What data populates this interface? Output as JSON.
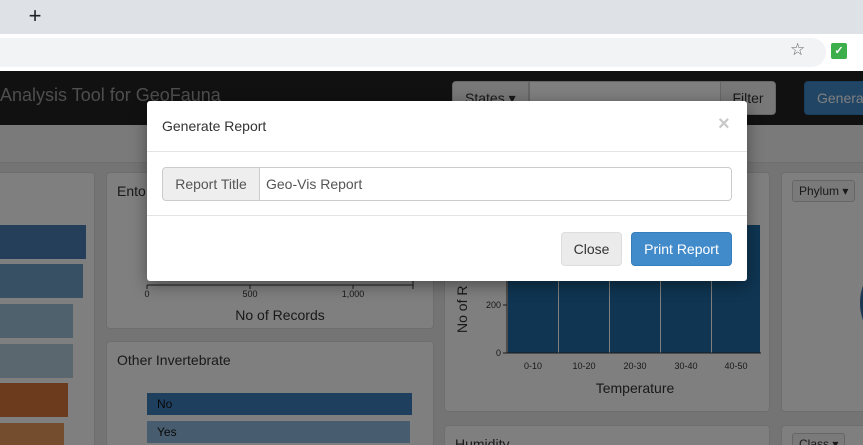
{
  "browser": {
    "new_tab_glyph": "+",
    "star_glyph": "☆",
    "extension_glyph": "✓"
  },
  "navbar": {
    "brand": "Analysis Tool for GeoFauna",
    "states_label": "States ▾",
    "filter_label": "Filter",
    "generate_label": "Genera"
  },
  "panels": {
    "ento_title": "Ento",
    "ento_xlabel": "No of Records",
    "ento_ticks": [
      "0",
      "500",
      "1,000"
    ],
    "invert_title": "Other Invertebrate",
    "invert_bars": [
      "No",
      "Yes"
    ],
    "temp_ylabel": "No of R",
    "temp_xlabel": "Temperature",
    "temp_yticks": [
      "200",
      "0"
    ],
    "temp_categories": [
      "0-10",
      "10-20",
      "20-30",
      "30-40",
      "40-50"
    ],
    "humidity_title": "Humidity",
    "phylum_label": "Phylum ▾",
    "class_label": "Class ▾"
  },
  "left_bar_colors": [
    "#4a7fb5",
    "#6fa0c8",
    "#9ec3da",
    "#b7cfdf",
    "#d9763a",
    "#e89a5c"
  ],
  "accent_color": "#428bca",
  "modal": {
    "title": "Generate Report",
    "close_glyph": "×",
    "field_label": "Report Title",
    "field_value": "Geo-Vis Report",
    "close_button": "Close",
    "print_button": "Print Report"
  }
}
